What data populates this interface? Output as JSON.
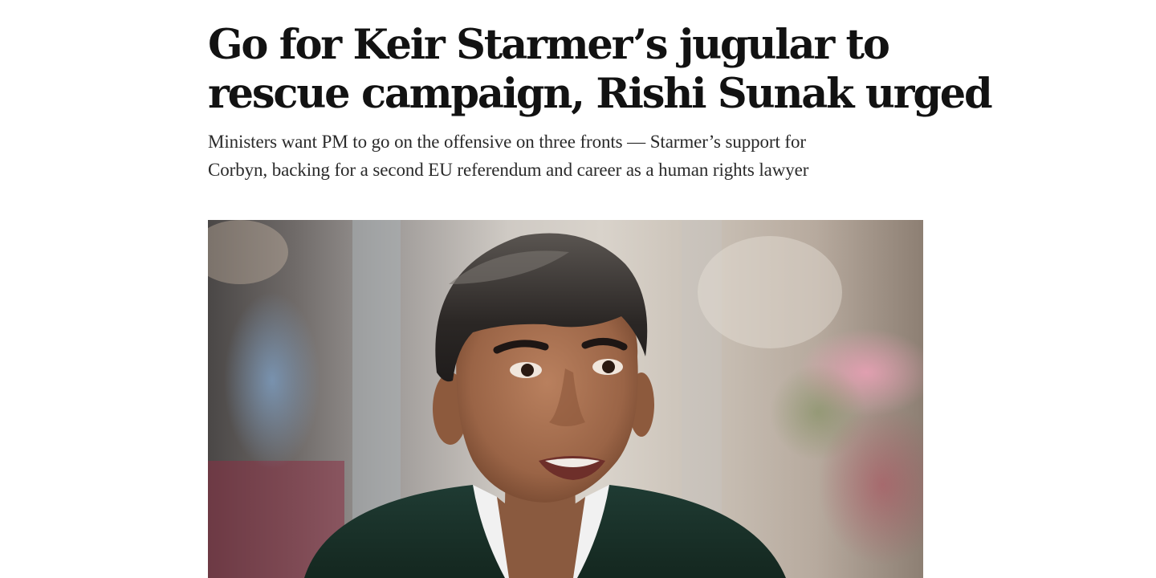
{
  "article": {
    "headline_lines": [
      "Go for Keir Starmer’s jugular to",
      "rescue campaign, Rishi Sunak urged"
    ],
    "standfirst_lines": [
      "Ministers want PM to go on the offensive on three fronts — Starmer’s support for",
      "Corbyn, backing for a second EU referendum and career as a human rights lawyer"
    ]
  },
  "hero_image": {
    "subject": "Rishi Sunak portrait photo"
  }
}
